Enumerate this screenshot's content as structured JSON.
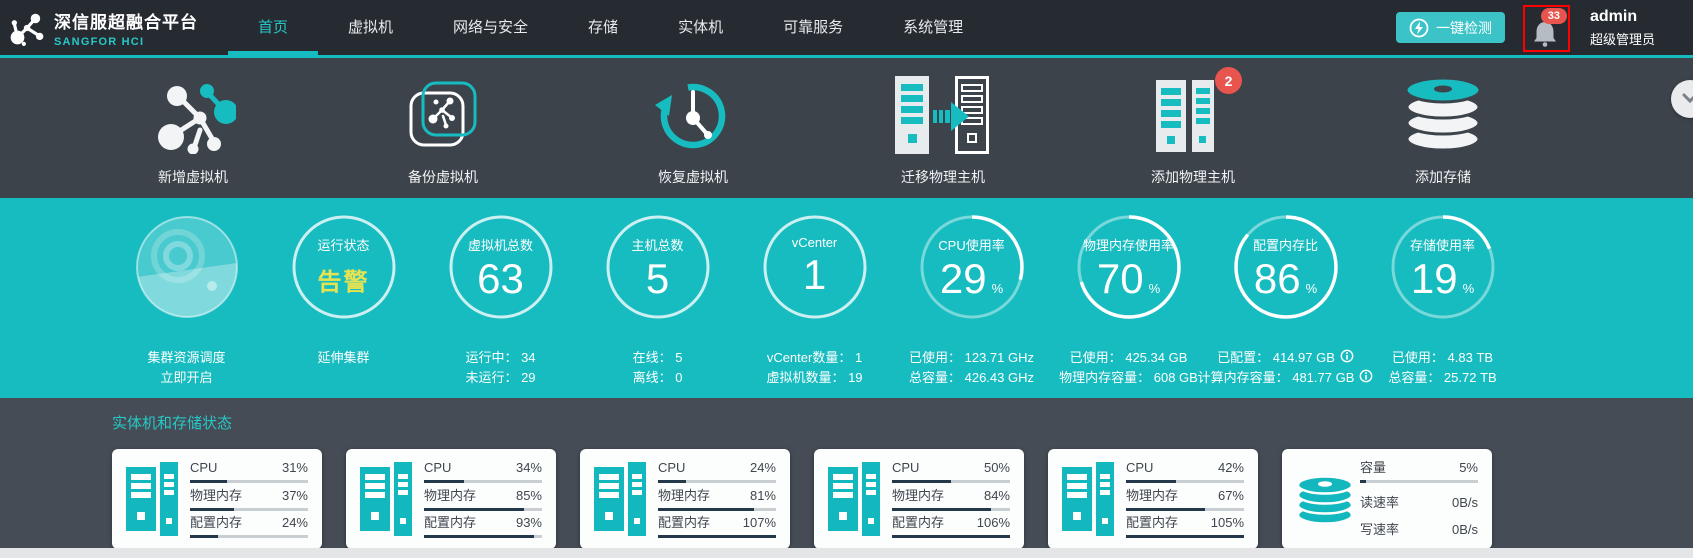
{
  "header": {
    "title": "深信服超融合平台",
    "subtitle": "SANGFOR HCI",
    "nav": [
      {
        "label": "首页"
      },
      {
        "label": "虚拟机"
      },
      {
        "label": "网络与安全"
      },
      {
        "label": "存储"
      },
      {
        "label": "实体机"
      },
      {
        "label": "可靠服务"
      },
      {
        "label": "系统管理"
      }
    ],
    "check_button": "一键检测",
    "notification_count": "33",
    "username": "admin",
    "role": "超级管理员"
  },
  "actions": [
    {
      "label": "新增虚拟机",
      "icon": "vm-molecule-icon"
    },
    {
      "label": "备份虚拟机",
      "icon": "vm-backup-icon"
    },
    {
      "label": "恢复虚拟机",
      "icon": "vm-restore-clock-icon"
    },
    {
      "label": "迁移物理主机",
      "icon": "host-migrate-icon"
    },
    {
      "label": "添加物理主机",
      "icon": "host-add-icon",
      "badge": "2"
    },
    {
      "label": "添加存储",
      "icon": "storage-add-icon"
    }
  ],
  "stats": [
    {
      "label1": "集群资源调度",
      "label2": "立即开启"
    },
    {
      "title": "运行状态",
      "value": "告警",
      "label1": "延伸集群",
      "label2": ""
    },
    {
      "title": "虚拟机总数",
      "value": "63",
      "label1": "运行中： 34",
      "label2": "未运行： 29"
    },
    {
      "title": "主机总数",
      "value": "5",
      "label1": "在线： 5",
      "label2": "离线： 0"
    },
    {
      "title": "vCenter",
      "value": "1",
      "label1": "vCenter数量： 1",
      "label2": "虚拟机数量： 19"
    },
    {
      "title": "CPU使用率",
      "value": "29",
      "unit": "%",
      "percent": 29,
      "label1": "已使用： 123.71 GHz",
      "label2": "总容量： 426.43 GHz"
    },
    {
      "title": "物理内存使用率",
      "value": "70",
      "unit": "%",
      "percent": 70,
      "label1": "已使用： 425.34 GB",
      "label2": "物理内存容量： 608 GB"
    },
    {
      "title": "配置内存比",
      "value": "86",
      "unit": "%",
      "percent": 86,
      "label1": "已配置： 414.97 GB",
      "label2": "计算内存容量： 481.77 GB"
    },
    {
      "title": "存储使用率",
      "value": "19",
      "unit": "%",
      "percent": 19,
      "label1": "已使用： 4.83 TB",
      "label2": "总容量： 25.72 TB"
    }
  ],
  "section": {
    "title": "实体机和存储状态",
    "cards": [
      {
        "rows": [
          {
            "label": "CPU",
            "value": "31%",
            "pct": 31
          },
          {
            "label": "物理内存",
            "value": "37%",
            "pct": 37
          },
          {
            "label": "配置内存",
            "value": "24%",
            "pct": 24
          }
        ]
      },
      {
        "rows": [
          {
            "label": "CPU",
            "value": "34%",
            "pct": 34
          },
          {
            "label": "物理内存",
            "value": "85%",
            "pct": 85
          },
          {
            "label": "配置内存",
            "value": "93%",
            "pct": 93
          }
        ]
      },
      {
        "rows": [
          {
            "label": "CPU",
            "value": "24%",
            "pct": 24
          },
          {
            "label": "物理内存",
            "value": "81%",
            "pct": 81
          },
          {
            "label": "配置内存",
            "value": "107%",
            "pct": 107
          }
        ]
      },
      {
        "rows": [
          {
            "label": "CPU",
            "value": "50%",
            "pct": 50
          },
          {
            "label": "物理内存",
            "value": "84%",
            "pct": 84
          },
          {
            "label": "配置内存",
            "value": "106%",
            "pct": 106
          }
        ]
      },
      {
        "rows": [
          {
            "label": "CPU",
            "value": "42%",
            "pct": 42
          },
          {
            "label": "物理内存",
            "value": "67%",
            "pct": 67
          },
          {
            "label": "配置内存",
            "value": "105%",
            "pct": 105
          }
        ]
      },
      {
        "rows": [
          {
            "label": "容量",
            "value": "5%",
            "pct": 5
          },
          {
            "label": "读速率",
            "value": "0B/s"
          },
          {
            "label": "写速率",
            "value": "0B/s"
          }
        ]
      }
    ]
  },
  "colors": {
    "teal": "#17bcc0",
    "warn_yellow": "#e6e352",
    "badge_red": "#e8544e",
    "annotation_red": "#ff0000",
    "bar_fill": "#24384c"
  }
}
